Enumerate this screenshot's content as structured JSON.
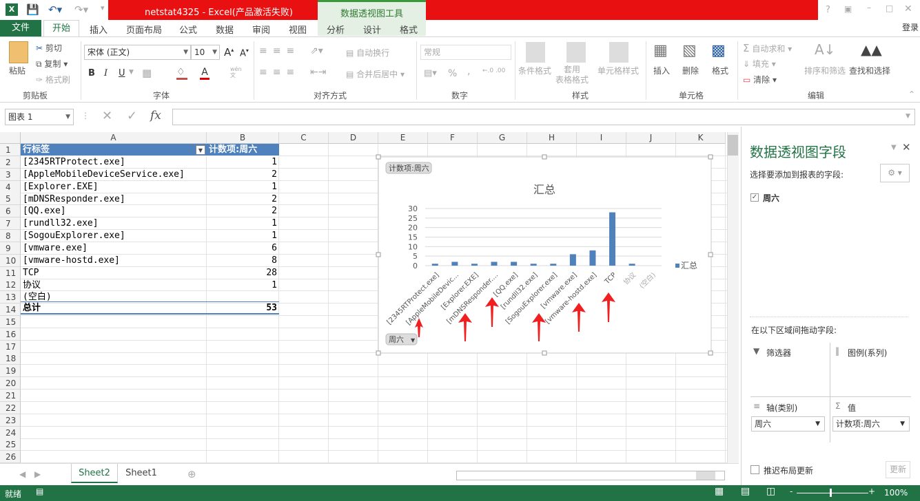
{
  "window": {
    "title": "netstat4325 -  Excel(产品激活失败)",
    "context_tab_group": "数据透视图工具",
    "login": "登录",
    "help": "?"
  },
  "tabs": [
    {
      "label": "文件"
    },
    {
      "label": "开始"
    },
    {
      "label": "插入"
    },
    {
      "label": "页面布局"
    },
    {
      "label": "公式"
    },
    {
      "label": "数据"
    },
    {
      "label": "审阅"
    },
    {
      "label": "视图"
    },
    {
      "label": "分析"
    },
    {
      "label": "设计"
    },
    {
      "label": "格式"
    }
  ],
  "ribbon": {
    "clipboard": {
      "paste": "粘贴",
      "cut": "剪切",
      "copy": "复制",
      "format_painter": "格式刷",
      "label": "剪贴板"
    },
    "font": {
      "name": "宋体 (正文)",
      "size": "10",
      "bold": "B",
      "italic": "I",
      "underline": "U",
      "label": "字体",
      "phonetic": "wén\n文"
    },
    "alignment": {
      "wrap": "自动换行",
      "merge": "合并后居中",
      "label": "对齐方式"
    },
    "number": {
      "format": "常规",
      "percent": "%",
      "comma": ",",
      "label": "数字"
    },
    "styles": {
      "conditional": "条件格式",
      "table": "套用\n表格格式",
      "cell": "单元格样式",
      "label": "样式"
    },
    "cells": {
      "insert": "插入",
      "delete": "删除",
      "format": "格式",
      "label": "单元格"
    },
    "editing": {
      "autosum": "自动求和",
      "fill": "填充",
      "clear": "清除",
      "sort": "排序和筛选",
      "find": "查找和选择",
      "label": "编辑"
    }
  },
  "formula_bar": {
    "name_box": "图表 1",
    "fx": "fx",
    "value": ""
  },
  "columns": [
    "A",
    "B",
    "C",
    "D",
    "E",
    "F",
    "G",
    "H",
    "I",
    "J",
    "K"
  ],
  "rows": [
    "1",
    "2",
    "3",
    "4",
    "5",
    "6",
    "7",
    "8",
    "9",
    "10",
    "11",
    "12",
    "13",
    "14",
    "15",
    "16",
    "17",
    "18",
    "19",
    "20",
    "21",
    "22",
    "23",
    "24",
    "25",
    "26"
  ],
  "pivot": {
    "header": {
      "row_label": "行标签",
      "value_label": "计数项:周六"
    },
    "data": [
      {
        "label": "[2345RTProtect.exe]",
        "value": "1"
      },
      {
        "label": "[AppleMobileDeviceService.exe]",
        "value": "2"
      },
      {
        "label": "[Explorer.EXE]",
        "value": "1"
      },
      {
        "label": "[mDNSResponder.exe]",
        "value": "2"
      },
      {
        "label": "[QQ.exe]",
        "value": "2"
      },
      {
        "label": "[rundll32.exe]",
        "value": "1"
      },
      {
        "label": "[SogouExplorer.exe]",
        "value": "1"
      },
      {
        "label": "[vmware.exe]",
        "value": "6"
      },
      {
        "label": "[vmware-hostd.exe]",
        "value": "8"
      },
      {
        "label": "TCP",
        "value": "28"
      },
      {
        "label": "协议",
        "value": "1"
      },
      {
        "label": "(空白)",
        "value": ""
      }
    ],
    "total": {
      "label": "总计",
      "value": "53"
    }
  },
  "chart_data": {
    "type": "bar",
    "title": "汇总",
    "value_field_button": "计数项:周六",
    "axis_field_button": "周六",
    "categories": [
      "[2345RTProtect.exe]",
      "[AppleMobileDevic...",
      "[Explorer.EXE]",
      "[mDNSResponder....",
      "[QQ.exe]",
      "[rundll32.exe]",
      "[SogouExplorer.exe]",
      "[vmware.exe]",
      "[vmware-hostd.exe]",
      "TCP",
      "协议",
      "(空白)"
    ],
    "series": [
      {
        "name": "汇总",
        "values": [
          1,
          2,
          1,
          2,
          2,
          1,
          1,
          6,
          8,
          28,
          1,
          0
        ]
      }
    ],
    "yticks": [
      "0",
      "5",
      "10",
      "15",
      "20",
      "25",
      "30"
    ],
    "ylim": [
      0,
      30
    ],
    "grid": true,
    "legend": "right",
    "color": "#4f81bd",
    "annotations": "red arrows"
  },
  "sheets": [
    {
      "label": "Sheet2",
      "active": true
    },
    {
      "label": "Sheet1",
      "active": false
    }
  ],
  "field_pane": {
    "title": "数据透视图字段",
    "choose": "选择要添加到报表的字段:",
    "fields": [
      {
        "label": "周六",
        "checked": true
      }
    ],
    "drag": "在以下区域间拖动字段:",
    "filters": "筛选器",
    "legend": "图例(系列)",
    "axis": "轴(类别)",
    "values": "值",
    "axis_item": "周六",
    "values_item": "计数项:周六",
    "defer": "推迟布局更新",
    "update": "更新"
  },
  "status": {
    "ready": "就绪",
    "zoom": "100%"
  },
  "colors": {
    "excel_green": "#217346",
    "title_red": "#e81010",
    "bar": "#4f81bd",
    "header_blue": "#4f81bd"
  }
}
